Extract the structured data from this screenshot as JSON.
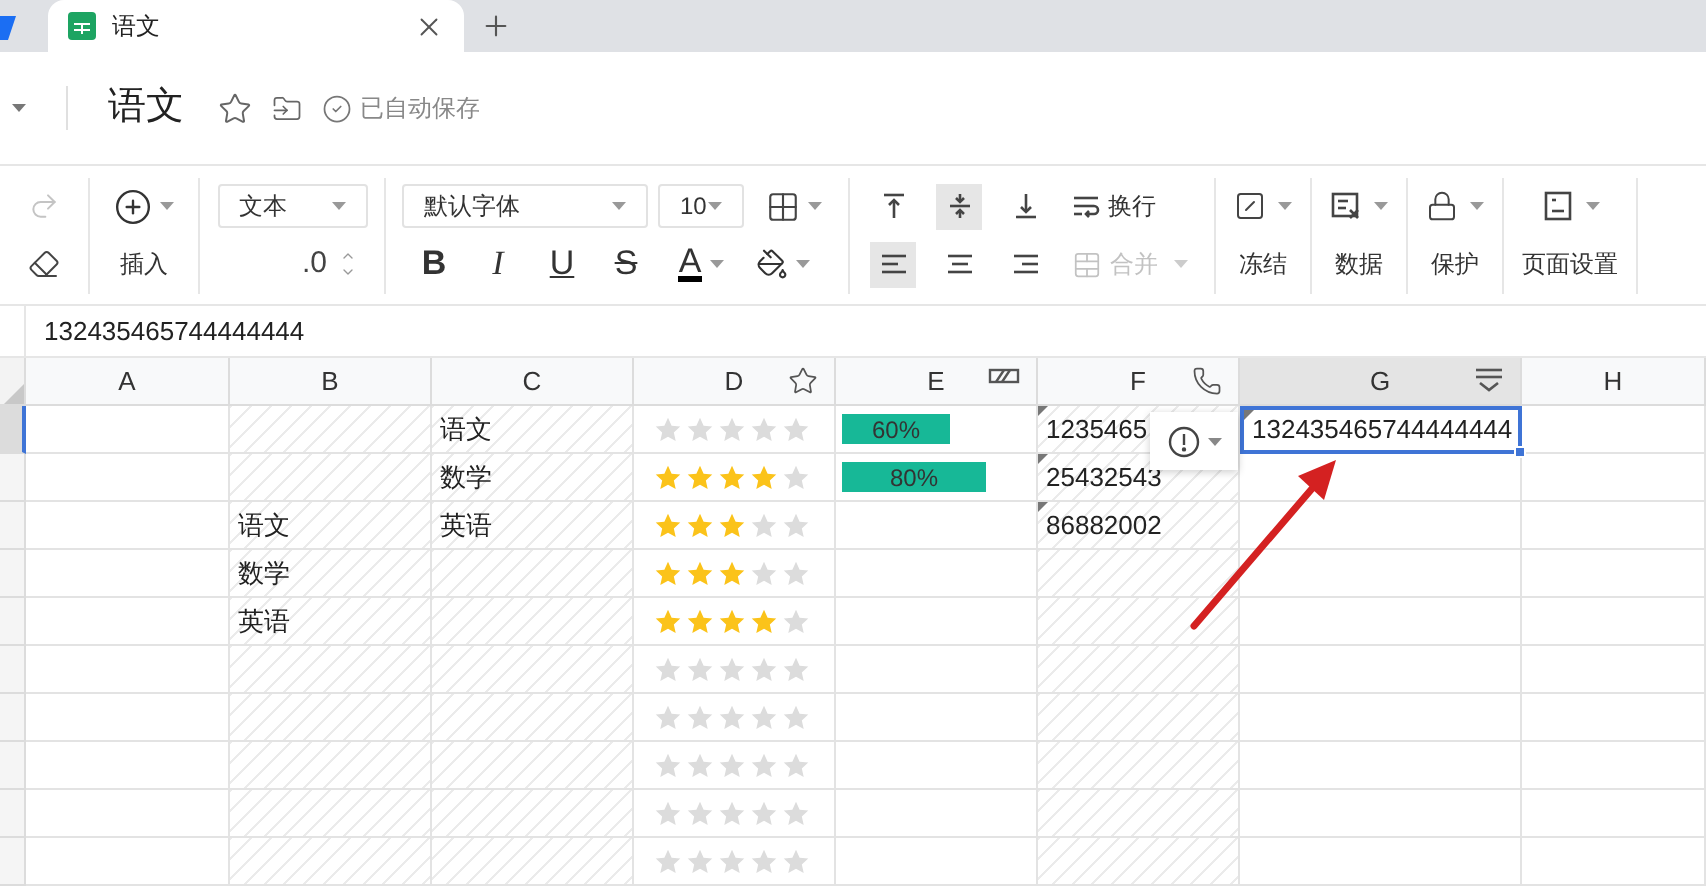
{
  "tab": {
    "title": "语文"
  },
  "document": {
    "title": "语文",
    "status": "已自动保存"
  },
  "toolbar": {
    "redo": {
      "disabled": true
    },
    "insert": {
      "label": "插入"
    },
    "number_format": {
      "value": "文本"
    },
    "decimal": ".0",
    "font": {
      "value": "默认字体"
    },
    "font_size": {
      "value": "10"
    },
    "text_styles": [
      "B",
      "I",
      "U",
      "S",
      "A"
    ],
    "vertical_align": [
      {
        "selected": false
      },
      {
        "selected": true
      },
      {
        "selected": false
      }
    ],
    "horizontal_align": [
      {
        "selected": true
      },
      {
        "selected": false
      },
      {
        "selected": false
      }
    ],
    "wrap": {
      "label": "换行"
    },
    "merge": {
      "label": "合并",
      "disabled": true
    },
    "tools": [
      {
        "label": "冻结"
      },
      {
        "label": "数据"
      },
      {
        "label": "保护"
      },
      {
        "label": "页面设置"
      }
    ]
  },
  "formula_bar": {
    "value": "132435465744444444"
  },
  "columns": [
    {
      "label": "A",
      "kind": "text",
      "hatched": false,
      "selected": false
    },
    {
      "label": "B",
      "kind": "text",
      "hatched": true,
      "selected": false
    },
    {
      "label": "C",
      "kind": "text",
      "hatched": true,
      "selected": false
    },
    {
      "label": "D",
      "kind": "rating",
      "hatched": false,
      "selected": false
    },
    {
      "label": "E",
      "kind": "progress",
      "hatched": false,
      "selected": false
    },
    {
      "label": "F",
      "kind": "phone",
      "hatched": true,
      "selected": false
    },
    {
      "label": "G",
      "kind": "dropdown",
      "hatched": false,
      "selected": true
    },
    {
      "label": "H",
      "kind": "text",
      "hatched": false,
      "selected": false
    }
  ],
  "rows": [
    {
      "selected": true,
      "cells": [
        null,
        null,
        {
          "text": "语文",
          "selected": false
        },
        {
          "stars": 0
        },
        {
          "level": 0.6,
          "reading": "60%"
        },
        {
          "text": "1235465",
          "flagged": true,
          "selected": false
        },
        {
          "text": "132435465744444444",
          "flagged": true,
          "selected": true
        },
        null
      ]
    },
    {
      "selected": false,
      "cells": [
        null,
        null,
        {
          "text": "数学",
          "selected": false
        },
        {
          "stars": 4
        },
        {
          "level": 0.8,
          "reading": "80%"
        },
        {
          "text": "25432543",
          "flagged": true,
          "selected": false
        },
        null,
        null
      ]
    },
    {
      "selected": false,
      "cells": [
        null,
        {
          "text": "语文",
          "selected": false
        },
        {
          "text": "英语",
          "selected": false
        },
        {
          "stars": 3
        },
        null,
        {
          "text": "86882002",
          "flagged": true,
          "selected": false
        },
        null,
        null
      ]
    },
    {
      "selected": false,
      "cells": [
        null,
        {
          "text": "数学",
          "selected": false
        },
        null,
        {
          "stars": 3
        },
        null,
        null,
        null,
        null
      ]
    },
    {
      "selected": false,
      "cells": [
        null,
        {
          "text": "英语",
          "selected": false
        },
        null,
        {
          "stars": 4
        },
        null,
        null,
        null,
        null
      ]
    },
    {
      "selected": false,
      "cells": [
        null,
        null,
        null,
        {
          "stars": 0
        },
        null,
        null,
        null,
        null
      ]
    },
    {
      "selected": false,
      "cells": [
        null,
        null,
        null,
        {
          "stars": 0
        },
        null,
        null,
        null,
        null
      ]
    },
    {
      "selected": false,
      "cells": [
        null,
        null,
        null,
        {
          "stars": 0
        },
        null,
        null,
        null,
        null
      ]
    },
    {
      "selected": false,
      "cells": [
        null,
        null,
        null,
        {
          "stars": 0
        },
        null,
        null,
        null,
        null
      ]
    },
    {
      "selected": false,
      "cells": [
        null,
        null,
        null,
        {
          "stars": 0
        },
        null,
        null,
        null,
        null
      ]
    }
  ]
}
